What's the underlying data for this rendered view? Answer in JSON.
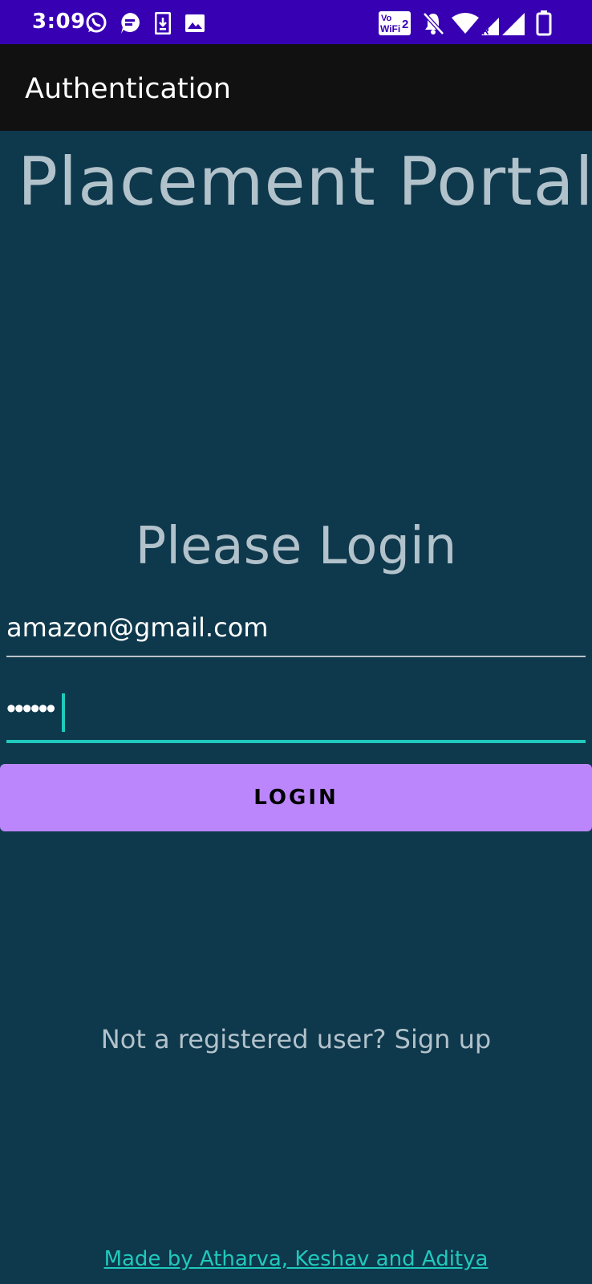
{
  "status_bar": {
    "time": "3:09",
    "notification_icons": [
      "whatsapp-icon",
      "message-icon",
      "download-icon",
      "image-icon"
    ],
    "system_icons": [
      "vowifi2-icon",
      "mute-icon",
      "wifi-icon",
      "signal-roaming-icon",
      "battery-icon"
    ],
    "vowifi_label_top": "Vo",
    "vowifi_label_bottom": "WiFi",
    "vowifi_label_num": "2",
    "roaming_label": "R"
  },
  "app_bar": {
    "title": "Authentication"
  },
  "main": {
    "portal_title": "Placement Portal",
    "login_heading": "Please Login",
    "email_value": "amazon@gmail.com",
    "password_masked": "••••••",
    "login_button_label": "LOGIN",
    "signup_text": "Not a registered user? Sign up",
    "credits_text": "Made by Atharva, Keshav and Aditya"
  },
  "colors": {
    "status_bar": "#3700b3",
    "app_bar": "#111111",
    "background": "#0e384c",
    "accent": "#20c9bc",
    "button": "#bb86fc"
  }
}
